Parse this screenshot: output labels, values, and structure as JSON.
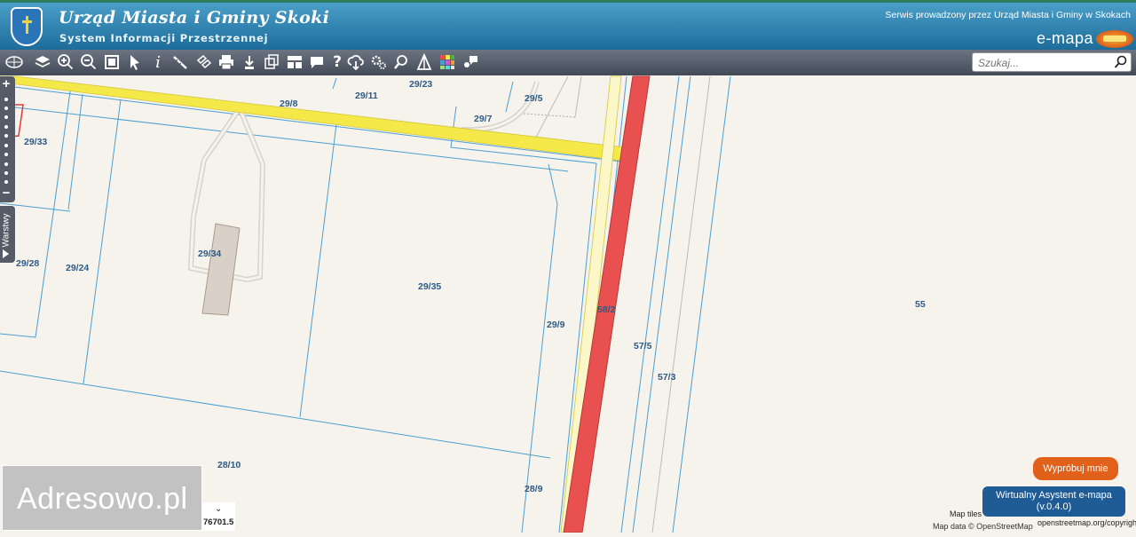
{
  "header": {
    "title": "Urząd Miasta i Gminy Skoki",
    "subtitle": "System Informacji Przestrzennej",
    "service_text": "Serwis prowadzony przez Urząd Miasta i Gminy w Skokach",
    "brand": "e-mapa",
    "crest_icon": "coat-of-arms-icon"
  },
  "toolbar": {
    "tools": [
      "globe-icon",
      "layers-icon",
      "zoom-in-icon",
      "zoom-out-icon",
      "full-extent-icon",
      "pointer-icon",
      "info-icon",
      "measure-icon",
      "link-icon",
      "print-icon",
      "upload-icon",
      "export-icon",
      "layout-icon",
      "help-icon",
      "chat-icon",
      "cloud-download-icon",
      "settings-icon",
      "search-map-icon",
      "triangle-icon",
      "grid-colors-icon",
      "user-chat-icon"
    ],
    "search_placeholder": "Szukaj..."
  },
  "sidebar": {
    "zoom_in": "+",
    "zoom_out": "−",
    "layers_label": "Warstwy"
  },
  "map": {
    "parcels": [
      "29/8",
      "29/11",
      "29/23",
      "29/5",
      "29/7",
      "29/33",
      "29/34",
      "29/28",
      "29/24",
      "29/35",
      "58/2",
      "29/9",
      "57/5",
      "57/3",
      "55",
      "28/10",
      "28/9"
    ],
    "colors": {
      "road_red": "#e8514f",
      "road_yellow": "#f5e94a",
      "parcel_line": "#4a9fd1",
      "background": "#f5f3ec"
    }
  },
  "watermark": "Adresowo.pl",
  "coordinate": "76701.5",
  "try_button": "Wypróbuj mnie",
  "assistant": {
    "line1": "Wirtualny Asystent e-mapa",
    "line2": "(v.0.4.0)"
  },
  "attribution": {
    "tiles": "Map tiles",
    "data": "Map data © OpenStreetMap",
    "copyright": "openstreetmap.org/copyright"
  }
}
